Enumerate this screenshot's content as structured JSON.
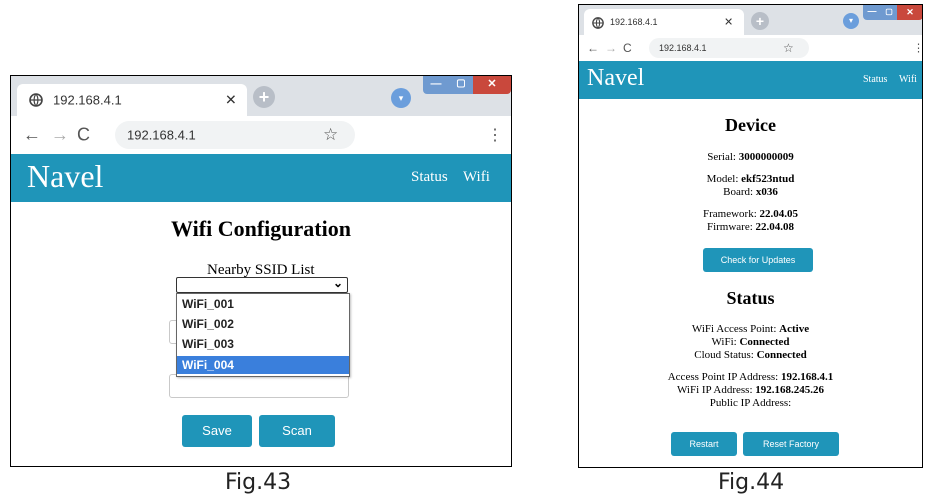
{
  "left": {
    "tab_title": "192.168.4.1",
    "address": "192.168.4.1",
    "brand": "Navel",
    "nav": [
      "Status",
      "Wifi"
    ],
    "heading": "Wifi Configuration",
    "ssid_label": "Nearby SSID List",
    "ssid_selected": "",
    "options": [
      "WiFi_001",
      "WiFi_002",
      "WiFi_003",
      "WiFi_004"
    ],
    "highlighted_option": "WiFi_004",
    "save_label": "Save",
    "scan_label": "Scan",
    "caption": "Fig.43"
  },
  "right": {
    "tab_title": "192.168.4.1",
    "address": "192.168.4.1",
    "brand": "Navel",
    "nav": [
      "Status",
      "Wifi"
    ],
    "device_heading": "Device",
    "serial_label": "Serial:",
    "serial_value": "3000000009",
    "model_label": "Model:",
    "model_value": "ekf523ntud",
    "board_label": "Board:",
    "board_value": "x036",
    "framework_label": "Framework:",
    "framework_value": "22.04.05",
    "firmware_label": "Firmware:",
    "firmware_value": "22.04.08",
    "check_updates_label": "Check for Updates",
    "status_heading": "Status",
    "ap_label": "WiFi Access Point:",
    "ap_value": "Active",
    "wifi_label": "WiFi:",
    "wifi_value": "Connected",
    "cloud_label": "Cloud Status:",
    "cloud_value": "Connected",
    "ap_ip_label": "Access Point IP Address:",
    "ap_ip_value": "192.168.4.1",
    "wifi_ip_label": "WiFi IP Address:",
    "wifi_ip_value": "192.168.245.26",
    "public_ip_label": "Public IP Address:",
    "restart_label": "Restart",
    "reset_label": "Reset Factory",
    "caption": "Fig.44"
  },
  "colors": {
    "accent": "#1f95b9",
    "highlight": "#3a7fdc",
    "tabstrip": "#dde1e6"
  }
}
